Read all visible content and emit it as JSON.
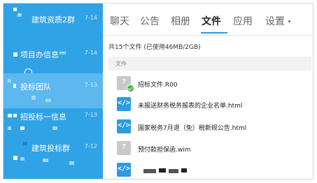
{
  "groups": [
    {
      "name": "建筑资质2群",
      "num": "7-14"
    },
    {
      "name": "项目办信息⺜",
      "num": "7-14"
    },
    {
      "name": "投标团队",
      "num": "7-13"
    },
    {
      "name": "招投标一信息",
      "num": "7-13"
    },
    {
      "name": "建筑投标群",
      "num": "7-12"
    }
  ],
  "tabs": [
    {
      "label": "聊天"
    },
    {
      "label": "公告"
    },
    {
      "label": "相册"
    },
    {
      "label": "文件"
    },
    {
      "label": "应用"
    },
    {
      "label": "设置"
    }
  ],
  "active_tab": "文件",
  "settings_caret": "▾",
  "summary": "共15个文件 (已使用46MB/2GB)",
  "column_header": "文件",
  "files": [
    {
      "name": "招标文件.R00",
      "type": "unknown",
      "icon_glyph": "?",
      "synced": true
    },
    {
      "name": "未报送财务税务报表的企业名单.html",
      "type": "html",
      "icon_glyph": "</>"
    },
    {
      "name": "国家税务7月退（免）税新规公告.html",
      "type": "html",
      "icon_glyph": "</>"
    },
    {
      "name": "预付款担保函.wim",
      "type": "unknown",
      "icon_glyph": "?"
    },
    {
      "name": "",
      "type": "html",
      "icon_glyph": "</>"
    }
  ],
  "colors": {
    "sidebar": "#2fa3e6",
    "sidebar_active": "#5cb8ee",
    "accent": "#2e9ae0"
  }
}
